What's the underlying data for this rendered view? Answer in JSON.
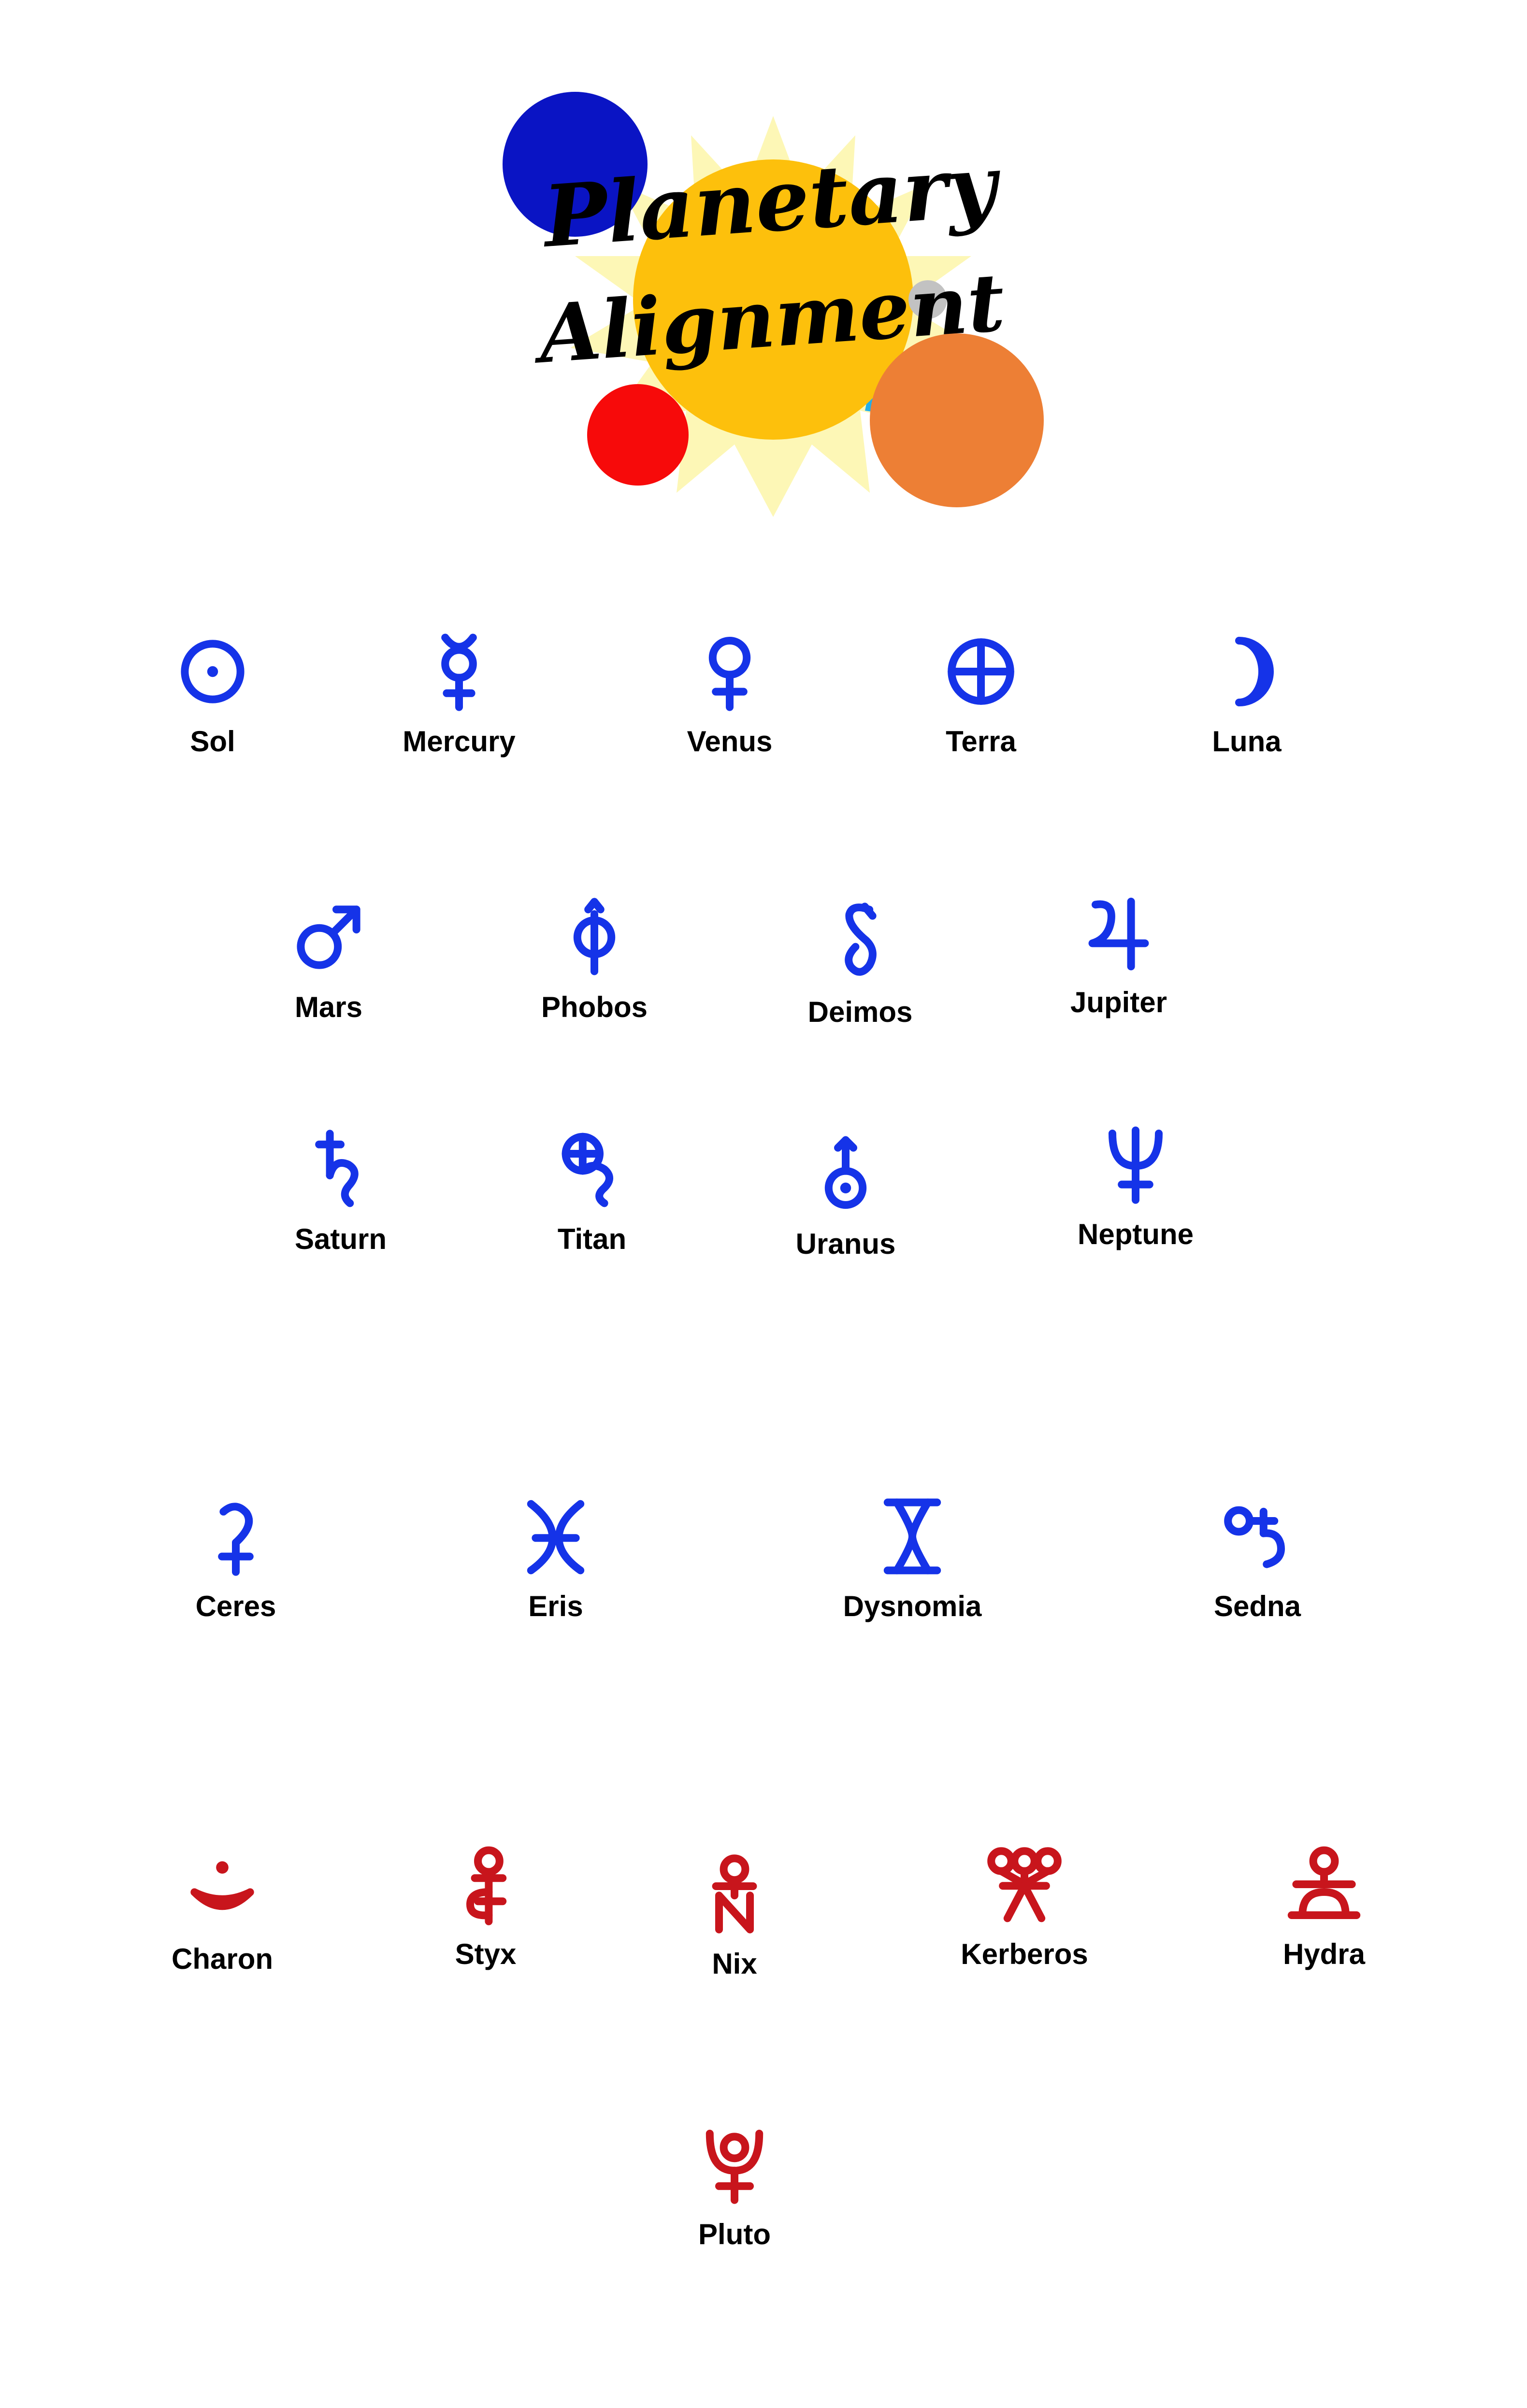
{
  "logo": {
    "line1": "Planetary",
    "line2": "Alignment",
    "colors": {
      "sun": "#fdc00c",
      "rays": "#fdf7b6",
      "blue_planet": "#0a14c4",
      "red_planet": "#f70a0a",
      "orange_planet": "#ed7f35",
      "grey_moon": "#c2c2c2",
      "cyan_rays": "#22aee9"
    }
  },
  "colors": {
    "planet_glyph": "#1533e8",
    "pluto_system_glyph": "#c8151c",
    "label": "#000000"
  },
  "bodies": {
    "sol": {
      "label": "Sol",
      "icon": "sol-icon"
    },
    "mercury": {
      "label": "Mercury",
      "icon": "mercury-icon"
    },
    "venus": {
      "label": "Venus",
      "icon": "venus-icon"
    },
    "terra": {
      "label": "Terra",
      "icon": "terra-icon"
    },
    "luna": {
      "label": "Luna",
      "icon": "luna-icon"
    },
    "mars": {
      "label": "Mars",
      "icon": "mars-icon"
    },
    "phobos": {
      "label": "Phobos",
      "icon": "phobos-icon"
    },
    "deimos": {
      "label": "Deimos",
      "icon": "deimos-icon"
    },
    "jupiter": {
      "label": "Jupiter",
      "icon": "jupiter-icon"
    },
    "saturn": {
      "label": "Saturn",
      "icon": "saturn-icon"
    },
    "titan": {
      "label": "Titan",
      "icon": "titan-icon"
    },
    "uranus": {
      "label": "Uranus",
      "icon": "uranus-icon"
    },
    "neptune": {
      "label": "Neptune",
      "icon": "neptune-icon"
    },
    "ceres": {
      "label": "Ceres",
      "icon": "ceres-icon"
    },
    "eris": {
      "label": "Eris",
      "icon": "eris-icon"
    },
    "dysnomia": {
      "label": "Dysnomia",
      "icon": "dysnomia-icon"
    },
    "sedna": {
      "label": "Sedna",
      "icon": "sedna-icon"
    },
    "charon": {
      "label": "Charon",
      "icon": "charon-icon"
    },
    "styx": {
      "label": "Styx",
      "icon": "styx-icon"
    },
    "nix": {
      "label": "Nix",
      "icon": "nix-icon"
    },
    "kerberos": {
      "label": "Kerberos",
      "icon": "kerberos-icon"
    },
    "hydra": {
      "label": "Hydra",
      "icon": "hydra-icon"
    },
    "pluto": {
      "label": "Pluto",
      "icon": "pluto-icon"
    }
  }
}
